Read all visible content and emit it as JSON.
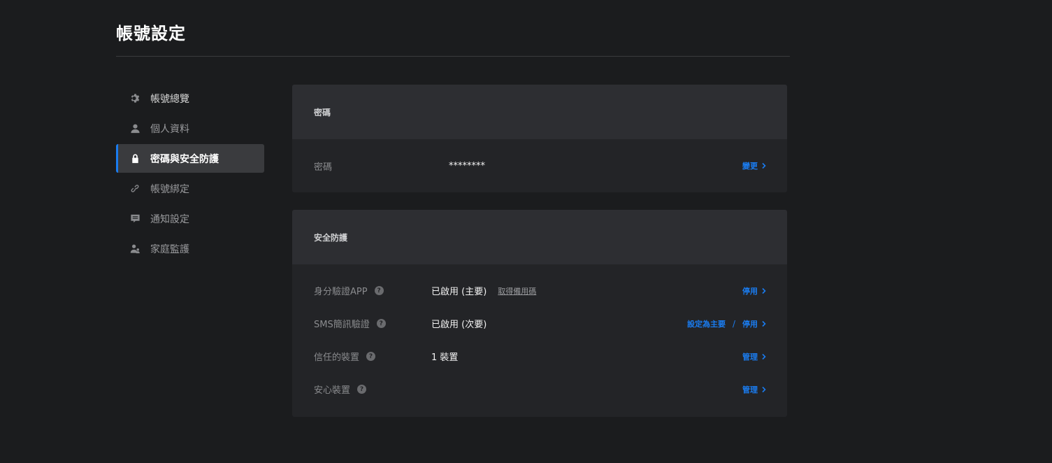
{
  "page": {
    "title": "帳號設定"
  },
  "sidebar": {
    "items": [
      {
        "label": "帳號總覽",
        "icon": "gear-icon"
      },
      {
        "label": "個人資料",
        "icon": "user-icon"
      },
      {
        "label": "密碼與安全防護",
        "icon": "lock-icon",
        "active": true
      },
      {
        "label": "帳號綁定",
        "icon": "link-icon"
      },
      {
        "label": "通知設定",
        "icon": "message-icon"
      },
      {
        "label": "家庭監護",
        "icon": "family-icon"
      }
    ]
  },
  "password_card": {
    "header": "密碼",
    "row": {
      "label": "密碼",
      "value": "********",
      "action": "變更"
    }
  },
  "security_card": {
    "header": "安全防護",
    "rows": [
      {
        "label": "身分驗證APP",
        "value": "已啟用 (主要)",
        "sub_link": "取得備用碼",
        "action": "停用"
      },
      {
        "label": "SMS簡訊驗證",
        "value": "已啟用 (次要)",
        "action_primary": "設定為主要",
        "separator": "/",
        "action": "停用"
      },
      {
        "label": "信任的裝置",
        "value": "1 裝置",
        "action": "管理"
      },
      {
        "label": "安心裝置",
        "value": "",
        "action": "管理"
      }
    ]
  },
  "colors": {
    "background": "#1b1c1e",
    "card": "#232427",
    "card_header": "#2d2e32",
    "accent": "#1a7cf0"
  }
}
